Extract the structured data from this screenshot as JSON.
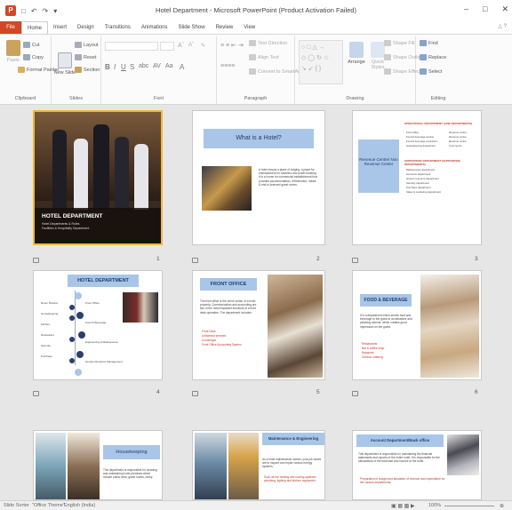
{
  "window": {
    "title": "Hotel Department - Microsoft PowerPoint (Product Activation Failed)",
    "app_icon": "P"
  },
  "tabs": [
    "File",
    "Home",
    "Insert",
    "Design",
    "Transitions",
    "Animations",
    "Slide Show",
    "Review",
    "View"
  ],
  "ribbon": {
    "clipboard": {
      "label": "Clipboard",
      "paste": "Paste",
      "cut": "Cut",
      "copy": "Copy",
      "format_painter": "Format Painter"
    },
    "slides": {
      "label": "Slides",
      "new_slide": "New Slide",
      "layout": "Layout",
      "reset": "Reset",
      "section": "Section"
    },
    "font": {
      "label": "Font"
    },
    "paragraph": {
      "label": "Paragraph",
      "text_direction": "Text Direction",
      "align_text": "Align Text",
      "convert_smartart": "Convert to SmartArt"
    },
    "drawing": {
      "label": "Drawing",
      "arrange": "Arrange",
      "quick_styles": "Quick Styles",
      "shape_fill": "Shape Fill",
      "shape_outline": "Shape Outline",
      "shape_effects": "Shape Effects"
    },
    "editing": {
      "label": "Editing",
      "find": "Find",
      "replace": "Replace",
      "select": "Select"
    }
  },
  "slides": [
    {
      "num": "1",
      "title": "HOTEL DEPARTMENT",
      "subtitle": "Hotel Departments & Roles",
      "sub2": "Facilities & Hospitality Department"
    },
    {
      "num": "2",
      "title": "What is a Hotel?",
      "body": "A hotel means a place of lodging, a place for entertainment for travelers and public building. It is a house for commercial establishment that provides accommodation, refreshment, meals & rest to licensed guest norms."
    },
    {
      "num": "3",
      "center": "Revenue Centre/ Non Revenue Center",
      "heading1": "OPERATIONAL DEPARTMENT (LINE DEPARTMENTS)",
      "list1": [
        "Front office",
        "Food & beverage service",
        "Food & beverage production",
        "Housekeeping department"
      ],
      "list1b": [
        "Revenue centre",
        "Revenue centre",
        "Revenue centre",
        "Cost centre"
      ],
      "heading2": "SUPPORTING DEPARTMENT (SUPPORTING DEPARTMENTS)",
      "list2": [
        "Maintenance department",
        "Accounts department",
        "Human resource department",
        "Security department",
        "Purchase department",
        "Sales & marketing department"
      ]
    },
    {
      "num": "4",
      "title": "HOTEL DEPARTMENT",
      "left": [
        "Room Division",
        "Housekeeping",
        "Kitchen",
        "Restaurant",
        "Security",
        "Purchase"
      ],
      "right": [
        "Front Office",
        "Food & Beverage",
        "Engineering & Maintenance",
        "Human Resource Management",
        "Sales and marketing"
      ]
    },
    {
      "num": "5",
      "title": "FRONT OFFICE",
      "body": "The front office is the nerve center of a hotel property. Communication and accounting are two of the most important functions of a front desk operation. The department includes:",
      "bullets": [
        "Front Desk",
        "Uniformed services",
        "Concierges",
        "Front Office Accounting System"
      ]
    },
    {
      "num": "6",
      "title": "FOOD & BEVERAGE",
      "body": "It is a department which serves food and beverage to the guest in an attractive and pleasing manner, which creates good impression on the guest.",
      "bullets": [
        "Restaurants",
        "Bar & coffee shop",
        "Banquets",
        "Outdoor catering"
      ]
    },
    {
      "num": "7",
      "title": "Housekeeping",
      "body": "This department is responsible for cleaning and maintaining hotel premises which include public area, guest rooms, lobby."
    },
    {
      "num": "8",
      "title": "Maintenance & Engineering",
      "body": "As a hotel maintenance worker, your job duties are to inspect and repair various energy systems.",
      "bullets": [
        "Such as the heating and cooling systems, plumbing, lighting and kitchen equipment."
      ]
    },
    {
      "num": "9",
      "title": "Account Department/Back office",
      "body": "This department is responsible for maintaining the financial statements and reports of the entire hotel. It is responsible for the calculations of the total sale and income of the hotel.",
      "bullets": [
        "Preparation of budget and allocation of revenue and expenditure for the various departments."
      ]
    }
  ],
  "status": {
    "view": "Slide Sorter",
    "theme": "\"Office Theme\"",
    "language": "English (India)",
    "zoom": "100%"
  },
  "colors": {
    "file_tab": "#d24726",
    "selection": "#f2b739",
    "title_box": "#a9c6e8",
    "sorter_bg": "#e6e6e6"
  }
}
